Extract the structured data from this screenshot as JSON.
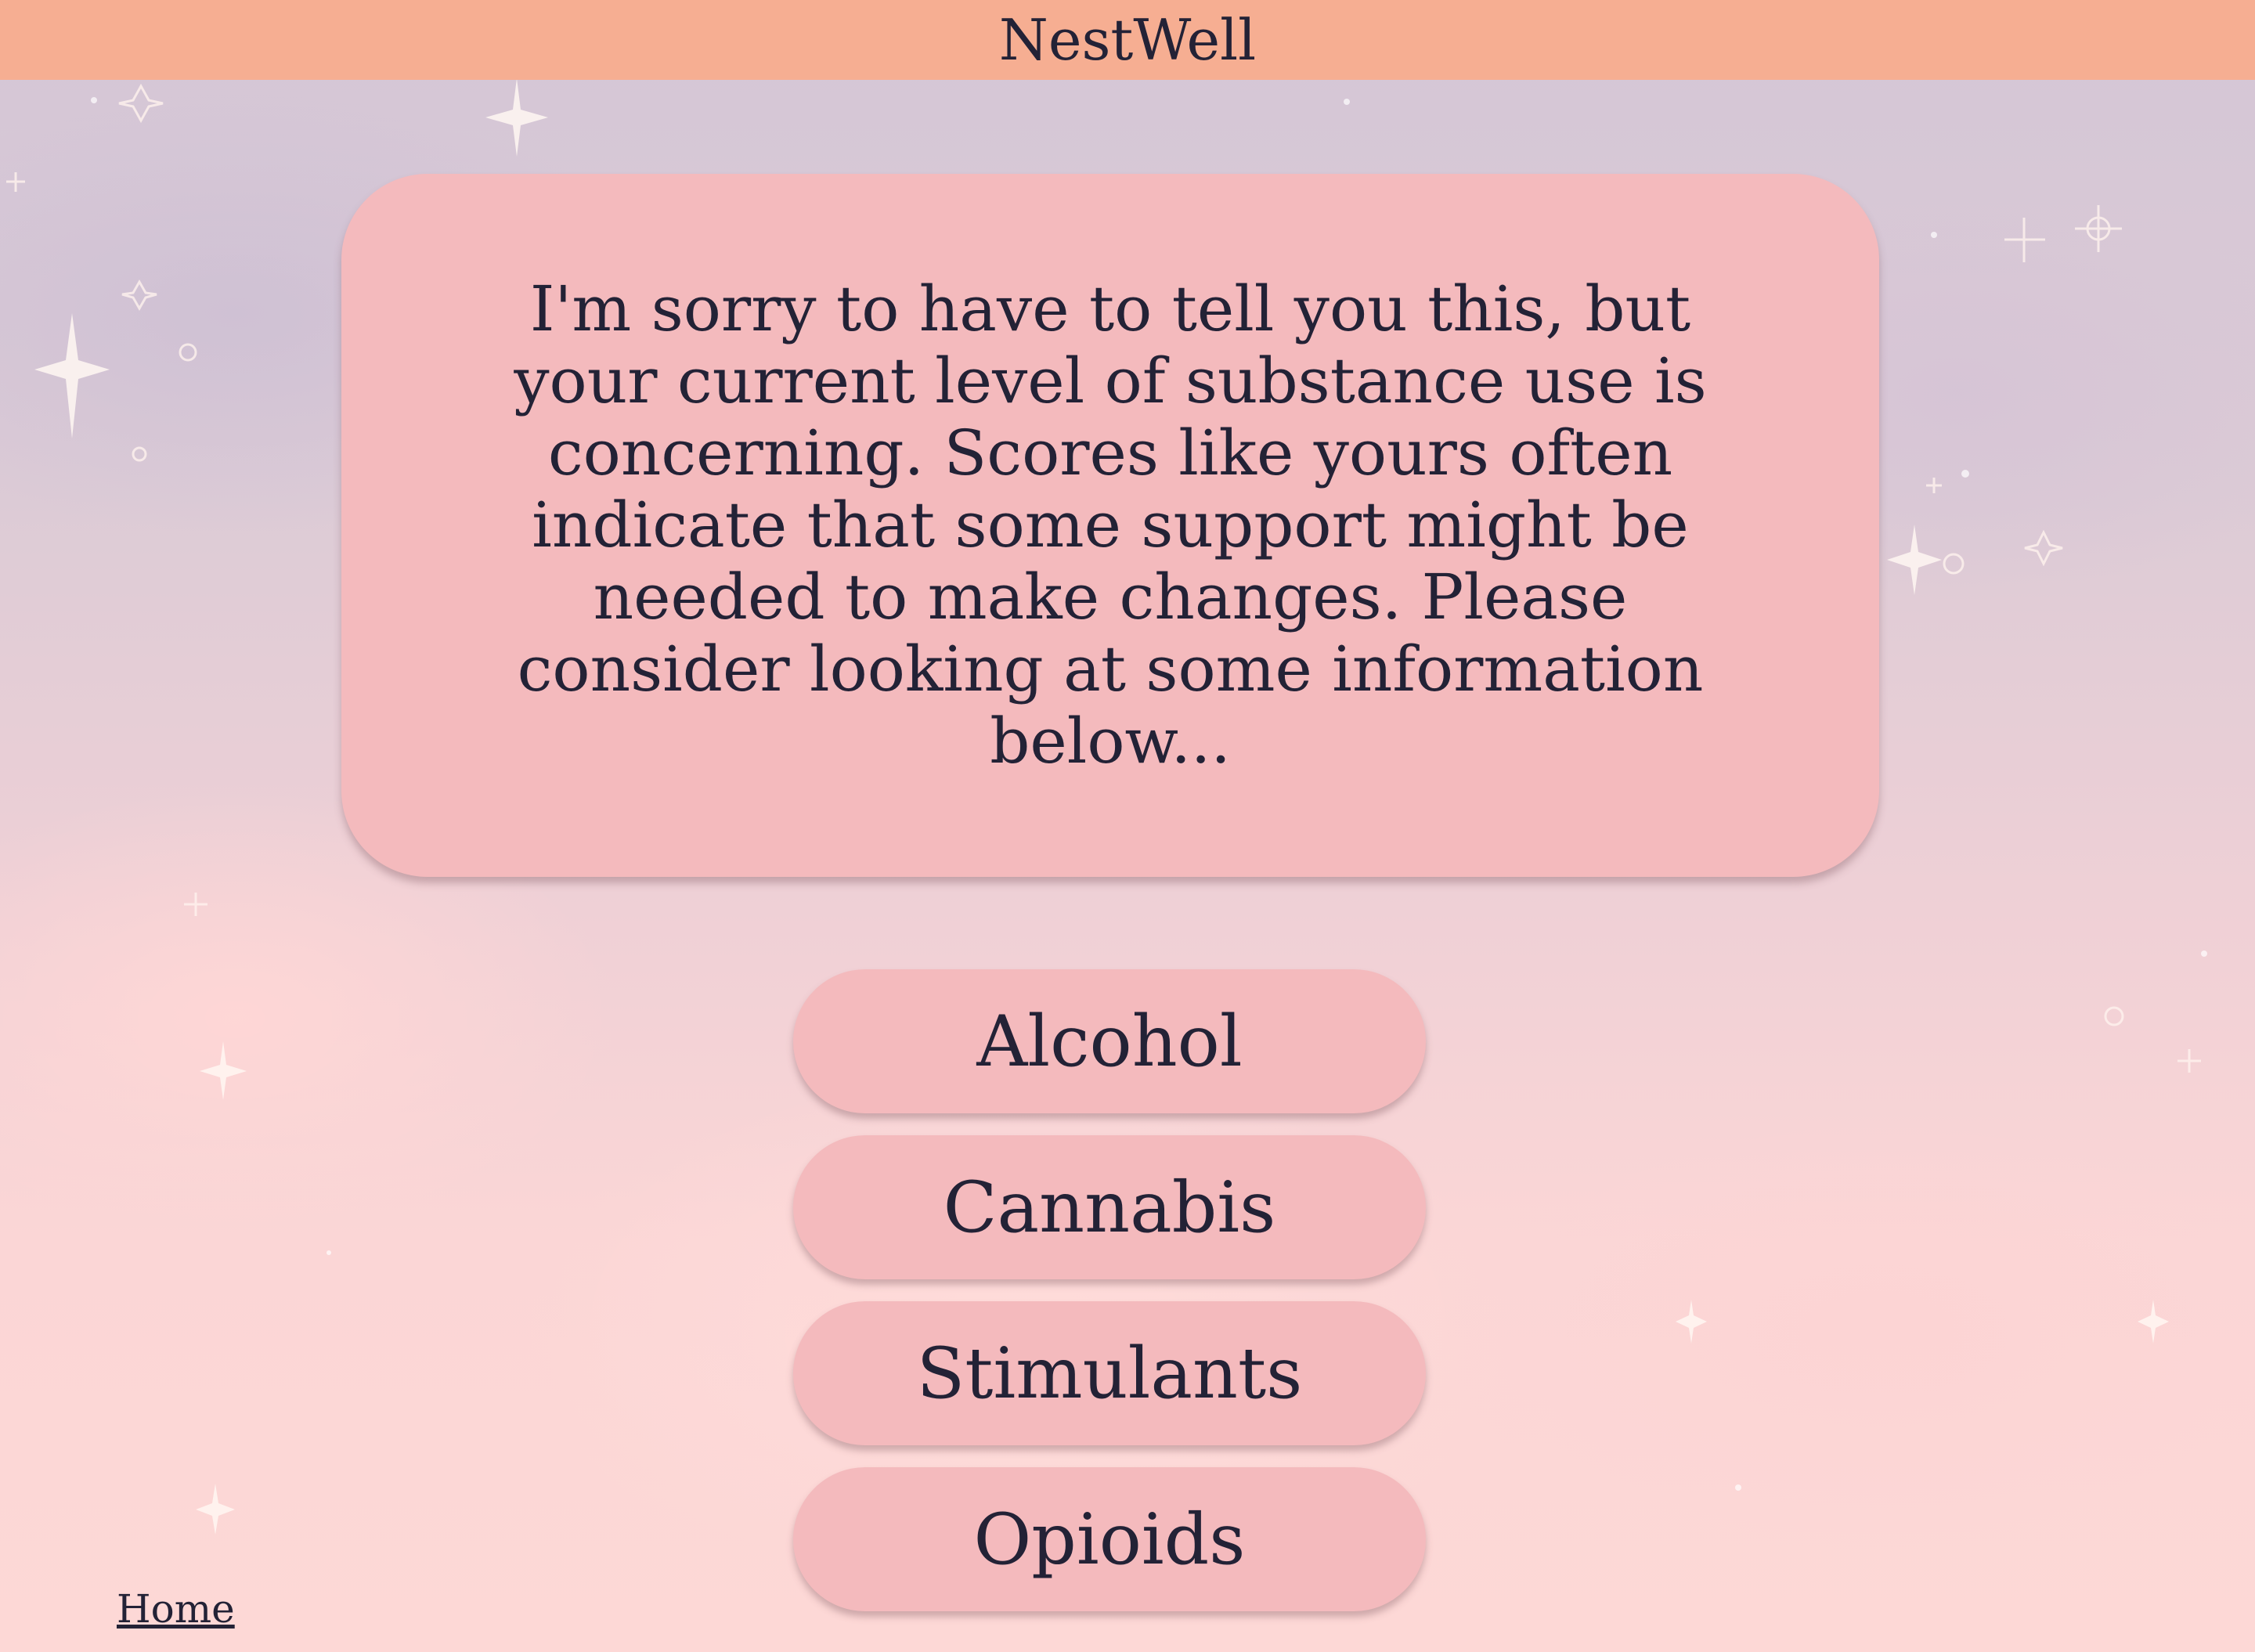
{
  "header": {
    "title": "NestWell"
  },
  "message": {
    "text": "I'm sorry to have to tell you this, but your current level of substance use is concerning. Scores like yours often indicate that some support might be needed to make changes. Please consider looking at some information below..."
  },
  "substances": [
    {
      "label": "Alcohol"
    },
    {
      "label": "Cannabis"
    },
    {
      "label": "Stimulants"
    },
    {
      "label": "Opioids"
    }
  ],
  "footer": {
    "home_label": "Home"
  },
  "colors": {
    "header_bg": "#f6ae92",
    "card_bg": "#f4babd",
    "text": "#232236"
  }
}
